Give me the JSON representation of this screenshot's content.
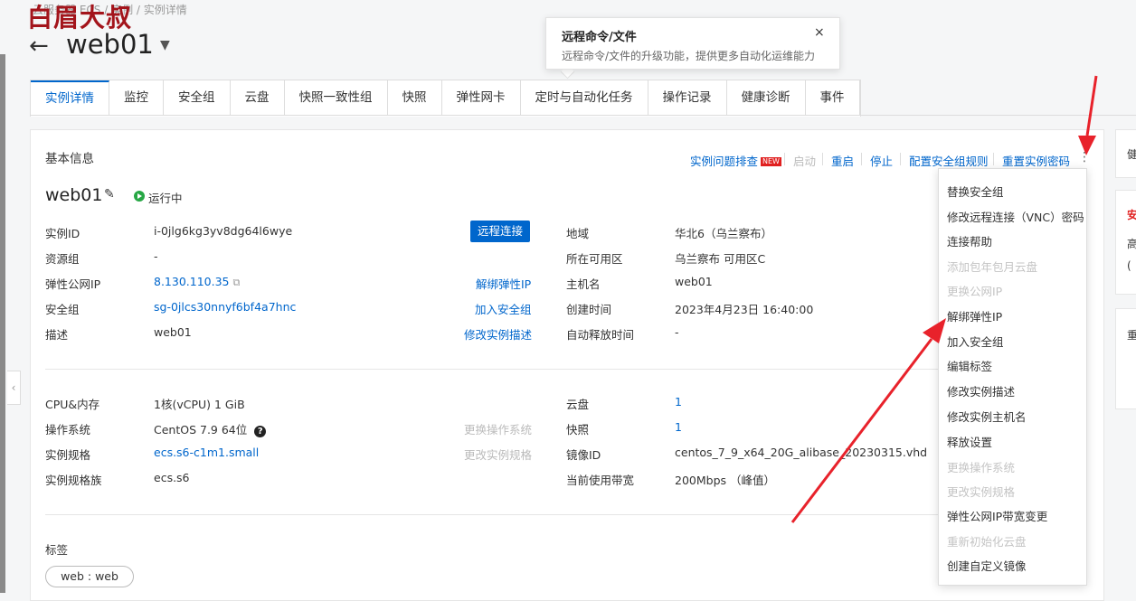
{
  "watermark": "白眉大叔",
  "breadcrumb": "云服务器 ECS / 实例 / 实例详情",
  "header": {
    "back_glyph": "←",
    "title": "web01",
    "caret_glyph": "▼"
  },
  "popover": {
    "title": "远程命令/文件",
    "description": "远程命令/文件的升级功能，提供更多自动化运维能力",
    "close_glyph": "×"
  },
  "tabs": [
    "实例详情",
    "监控",
    "安全组",
    "云盘",
    "快照一致性组",
    "快照",
    "弹性网卡",
    "定时与自动化任务",
    "操作记录",
    "健康诊断",
    "事件"
  ],
  "basic": {
    "section_title": "基本信息",
    "actions": {
      "troubleshoot": "实例问题排查",
      "new_badge": "NEW",
      "start": "启动",
      "restart": "重启",
      "stop": "停止",
      "sg_rules": "配置安全组规则",
      "reset_pwd": "重置实例密码",
      "more_glyph": "⋮"
    },
    "instance_name": "web01",
    "status": "运行中",
    "remote_btn": "远程连接",
    "rows1": {
      "instance_id_label": "实例ID",
      "instance_id": "i-0jlg6kg3yv8dg64l6wye",
      "resource_group_label": "资源组",
      "resource_group": "-",
      "eip_label": "弹性公网IP",
      "eip": "8.130.110.35",
      "eip_action": "解绑弹性IP",
      "sg_label": "安全组",
      "sg": "sg-0jlcs30nnyf6bf4a7hnc",
      "sg_action": "加入安全组",
      "desc_label": "描述",
      "desc": "web01",
      "desc_action": "修改实例描述",
      "region_label": "地域",
      "region": "华北6（乌兰察布）",
      "zone_label": "所在可用区",
      "zone": "乌兰察布 可用区C",
      "hostname_label": "主机名",
      "hostname": "web01",
      "created_label": "创建时间",
      "created": "2023年4月23日 16:40:00",
      "release_label": "自动释放时间",
      "release": "-"
    },
    "rows2": {
      "cpu_label": "CPU&内存",
      "cpu": "1核(vCPU) 1 GiB",
      "os_label": "操作系统",
      "os": "CentOS 7.9 64位",
      "os_action": "更换操作系统",
      "spec_label": "实例规格",
      "spec": "ecs.s6-c1m1.small",
      "spec_action": "更改实例规格",
      "family_label": "实例规格族",
      "family": "ecs.s6",
      "disk_label": "云盘",
      "disk": "1",
      "snapshot_label": "快照",
      "snapshot": "1",
      "image_label": "镜像ID",
      "image": "centos_7_9_x64_20G_alibase_20230315.vhd",
      "bandwidth_label": "当前使用带宽",
      "bandwidth": "200Mbps （峰值）"
    },
    "tags_label": "标签",
    "tag": "web : web"
  },
  "side": [
    "健",
    "安",
    "高",
    "(",
    "重"
  ],
  "dropdown": [
    {
      "label": "替换安全组",
      "disabled": false
    },
    {
      "label": "修改远程连接（VNC）密码",
      "disabled": false
    },
    {
      "label": "连接帮助",
      "disabled": false
    },
    {
      "label": "添加包年包月云盘",
      "disabled": true
    },
    {
      "label": "更换公网IP",
      "disabled": true
    },
    {
      "label": "解绑弹性IP",
      "disabled": false
    },
    {
      "label": "加入安全组",
      "disabled": false
    },
    {
      "label": "编辑标签",
      "disabled": false
    },
    {
      "label": "修改实例描述",
      "disabled": false
    },
    {
      "label": "修改实例主机名",
      "disabled": false
    },
    {
      "label": "释放设置",
      "disabled": false
    },
    {
      "label": "更换操作系统",
      "disabled": true
    },
    {
      "label": "更改实例规格",
      "disabled": true
    },
    {
      "label": "弹性公网IP带宽变更",
      "disabled": false
    },
    {
      "label": "重新初始化云盘",
      "disabled": true
    },
    {
      "label": "创建自定义镜像",
      "disabled": false
    }
  ],
  "colors": {
    "accent": "#0066cc",
    "arrow": "#e8222b",
    "status": "#27a745"
  }
}
